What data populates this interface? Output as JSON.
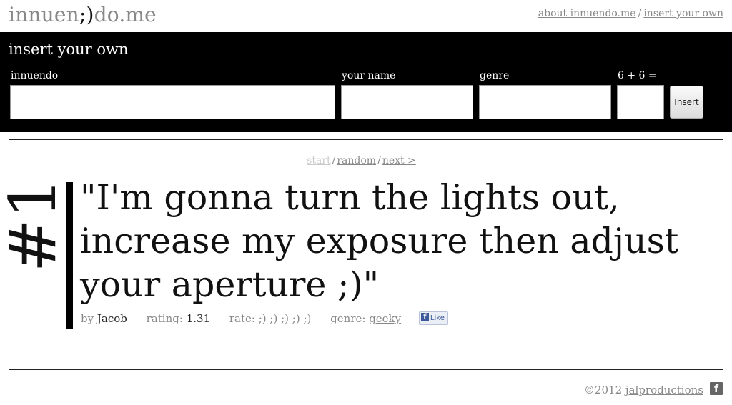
{
  "header": {
    "logo_part1": "innuen",
    "logo_wink": ";)",
    "logo_part2": "do.me",
    "nav": {
      "about_label": "about innuendo.me",
      "separator": "/",
      "insert_label": "insert your own"
    }
  },
  "form": {
    "title": "insert your own",
    "fields": {
      "innuendo": {
        "label": "innuendo",
        "value": ""
      },
      "name": {
        "label": "your name",
        "value": ""
      },
      "genre": {
        "label": "genre",
        "value": ""
      },
      "captcha": {
        "label": "6 + 6 =",
        "value": ""
      }
    },
    "submit_label": "Insert"
  },
  "pager": {
    "start_label": "start",
    "random_label": "random",
    "next_label": "next >",
    "separator": "/"
  },
  "entry": {
    "rank": "#1",
    "quote": "\"I'm gonna turn the lights out, increase my exposure then adjust your aperture ;)\"",
    "by_label": "by",
    "author": "Jacob",
    "rating_label": "rating:",
    "rating": "1.31",
    "rate_label": "rate:",
    "rate_options": [
      ";)",
      ";)",
      ";)",
      ";)",
      ";)"
    ],
    "genre_label": "genre:",
    "genre": "geeky",
    "like_label": "Like"
  },
  "footer": {
    "copyright": "©2012",
    "company": "jalproductions"
  },
  "colors": {
    "form_bar_bg": "#000000",
    "muted_text": "#888888",
    "facebook_blue": "#3b5998"
  },
  "icons": {
    "like": "facebook-like-icon",
    "footer": "facebook-icon"
  }
}
